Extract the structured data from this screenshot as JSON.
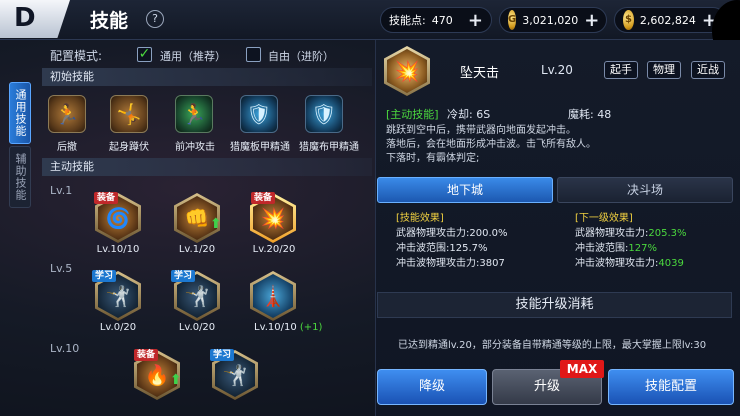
{
  "header": {
    "back_icon_glyph": "D",
    "title": "技能",
    "help_glyph": "?",
    "skill_points_label": "技能点:",
    "skill_points_value": "470",
    "gold_value": "3,021,020",
    "gold2_value": "2,602,824",
    "plus_glyph": "+"
  },
  "side_tabs": [
    {
      "label": "通用技能",
      "active": true
    },
    {
      "label": "辅助技能",
      "active": false
    }
  ],
  "config": {
    "label": "配置模式:",
    "option1": "通用（推荐）",
    "option1_checked": true,
    "option2": "自由（进阶）",
    "option2_checked": false,
    "check_glyph": "✓"
  },
  "sections": {
    "initial": "初始技能",
    "active": "主动技能"
  },
  "initial_skills": [
    {
      "name": "后撤",
      "icon": "retreat-icon",
      "glyph": "🏃"
    },
    {
      "name": "起身蹲伏",
      "icon": "crouch-icon",
      "glyph": "🤸"
    },
    {
      "name": "前冲攻击",
      "icon": "dash-attack-icon",
      "glyph": "🏃"
    },
    {
      "name": "猎魔板甲精通",
      "icon": "plate-armor-icon",
      "glyph": "🛡"
    },
    {
      "name": "猎魔布甲精通",
      "icon": "cloth-armor-icon",
      "glyph": "🛡"
    }
  ],
  "levels": [
    "Lv.1",
    "Lv.5",
    "Lv.10"
  ],
  "active_skills": [
    {
      "row": 0,
      "badge": "装备",
      "badge_type": "equip",
      "level": "Lv.10/10",
      "bonus": "",
      "arrow": false,
      "style": "normal",
      "glyph": "🌀"
    },
    {
      "row": 0,
      "badge": "",
      "badge_type": "",
      "level": "Lv.1/20",
      "bonus": "",
      "arrow": true,
      "style": "normal",
      "glyph": "👊"
    },
    {
      "row": 0,
      "badge": "装备",
      "badge_type": "equip",
      "level": "Lv.20/20",
      "bonus": "",
      "arrow": false,
      "style": "selected",
      "glyph": "💥"
    },
    {
      "row": 1,
      "badge": "学习",
      "badge_type": "learn",
      "level": "Lv.0/20",
      "bonus": "",
      "arrow": false,
      "style": "dim",
      "glyph": "🤺"
    },
    {
      "row": 1,
      "badge": "学习",
      "badge_type": "learn",
      "level": "Lv.0/20",
      "bonus": "",
      "arrow": false,
      "style": "dim",
      "glyph": "🤺"
    },
    {
      "row": 1,
      "badge": "",
      "badge_type": "",
      "level": "Lv.10/10",
      "bonus": "(+1)",
      "arrow": false,
      "style": "blueh",
      "glyph": "🗼"
    },
    {
      "row": 2,
      "badge": "装备",
      "badge_type": "equip",
      "level": "",
      "bonus": "",
      "arrow": true,
      "style": "normal",
      "glyph": "🔥"
    },
    {
      "row": 2,
      "badge": "学习",
      "badge_type": "learn",
      "level": "",
      "bonus": "",
      "arrow": false,
      "style": "dim",
      "glyph": "🤺"
    }
  ],
  "detail": {
    "name": "坠天击",
    "level": "Lv.20",
    "tags": [
      "起手",
      "物理",
      "近战"
    ],
    "type_label": "[主动技能]",
    "cooldown": "冷却: 6S",
    "mana": "魔耗: 48",
    "description": [
      "跳跃到空中后，携带武器向地面发起冲击。",
      "落地后，会在地面形成冲击波。击飞所有敌人。",
      "下落时，有霸体判定;"
    ],
    "tab_dungeon": "地下城",
    "tab_arena": "决斗场",
    "current_head": "[技能效果]",
    "current_lines": [
      {
        "label": "武器物理攻击力:",
        "value": "200.0%"
      },
      {
        "label": "冲击波范围:",
        "value": "125.7%"
      },
      {
        "label": "冲击波物理攻击力:",
        "value": "3807"
      }
    ],
    "next_head": "[下一级效果]",
    "next_lines": [
      {
        "label": "武器物理攻击力:",
        "value": "205.3%"
      },
      {
        "label": "冲击波范围:",
        "value": "127%"
      },
      {
        "label": "冲击波物理攻击力:",
        "value": "4039"
      }
    ],
    "upgrade_cost_title": "技能升级消耗",
    "upgrade_note": "已达到精通lv.20，部分装备自带精通等级的上限，最大掌握上限lv:30",
    "btn_down": "降级",
    "btn_up": "升级",
    "max_badge": "MAX",
    "btn_config": "技能配置"
  }
}
